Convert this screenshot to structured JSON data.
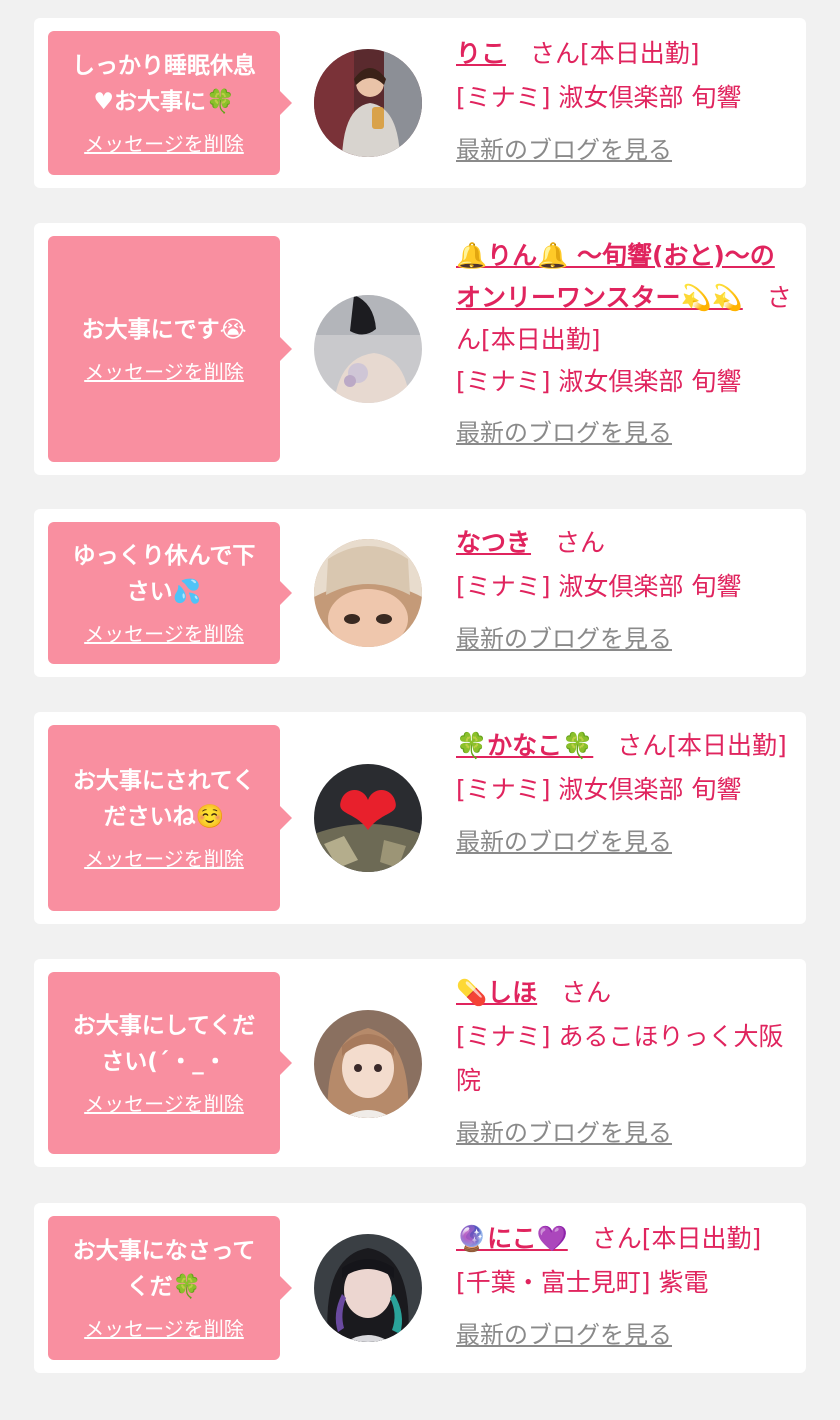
{
  "entries": [
    {
      "message": "しっかり睡眠休息\n♥お大事に🍀",
      "delete_label": "メッセージを削除",
      "name": "りこ",
      "suffix": "さん[本日出勤]",
      "shop": "[ミナミ] 淑女倶楽部 旬響",
      "blog_label": "最新のブログを見る"
    },
    {
      "message": "お大事にです😭",
      "delete_label": "メッセージを削除",
      "name": "🔔りん🔔 〜旬響(おと)〜のオンリーワンスター💫💫",
      "suffix": "さん[本日出勤]",
      "shop": "[ミナミ] 淑女倶楽部 旬響",
      "blog_label": "最新のブログを見る"
    },
    {
      "message": "ゆっくり休んで下\nさい💦",
      "delete_label": "メッセージを削除",
      "name": "なつき",
      "suffix": "さん",
      "shop": "[ミナミ] 淑女倶楽部 旬響",
      "blog_label": "最新のブログを見る"
    },
    {
      "message": "お大事にされてく\nださいね☺️",
      "delete_label": "メッセージを削除",
      "name": "🍀かなこ🍀",
      "suffix": "さん[本日出勤]",
      "shop": "[ミナミ] 淑女倶楽部 旬響",
      "blog_label": "最新のブログを見る"
    },
    {
      "message": "お大事にしてくだ\nさい(´・_・",
      "delete_label": "メッセージを削除",
      "name": "💊しほ",
      "suffix": "さん",
      "shop": "[ミナミ] あるこほりっく大阪院",
      "blog_label": "最新のブログを見る"
    },
    {
      "message": "お大事になさって\nくだ🍀",
      "delete_label": "メッセージを削除",
      "name": "🔮にこ💜",
      "suffix": "さん[本日出勤]",
      "shop": "[千葉・富士見町] 紫電",
      "blog_label": "最新のブログを見る"
    }
  ],
  "colors": {
    "page_background": "#f1f1f1",
    "bubble": "#f98fa0",
    "accent_text": "#e0245e",
    "muted_link": "#8a8a8a"
  }
}
